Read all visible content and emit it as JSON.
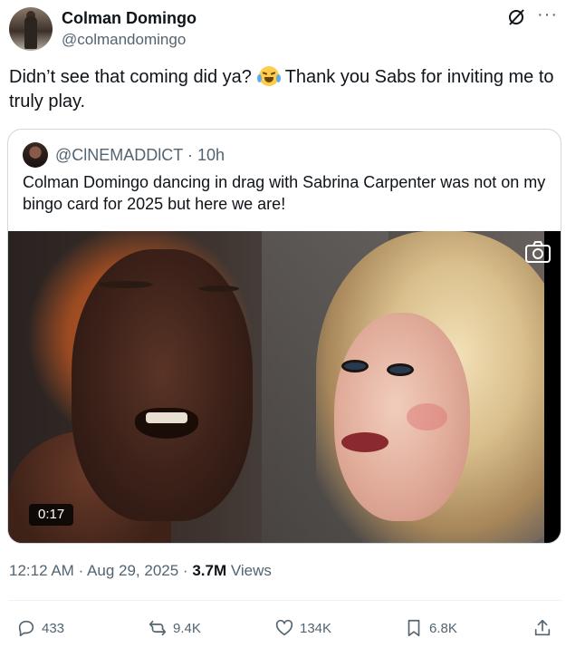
{
  "author": {
    "name": "Colman Domingo",
    "handle": "@colmandomingo"
  },
  "tweet": {
    "text_before_emoji": "Didn’t see that coming did ya?",
    "emoji": "face-with-tears-of-joy",
    "text_after_emoji": "Thank you Sabs for inviting me to truly play."
  },
  "quote": {
    "handle": "@ClNEMADDlCT",
    "separator": "·",
    "time": "10h",
    "text": "Colman Domingo dancing in drag with Sabrina Carpenter was not on my bingo card for 2025 but here we are!",
    "video_duration": "0:17"
  },
  "meta": {
    "time": "12:12 AM",
    "separator1": "·",
    "date": "Aug 29, 2025",
    "separator2": "·",
    "views_count": "3.7M",
    "views_label": "Views"
  },
  "actions": {
    "replies": "433",
    "reposts": "9.4K",
    "likes": "134K",
    "bookmarks": "6.8K"
  },
  "icons": [
    "grok-icon",
    "more-icon",
    "camera-icon",
    "reply-icon",
    "repost-icon",
    "like-icon",
    "bookmark-icon",
    "share-icon"
  ],
  "colors": {
    "text_primary": "#0f1419",
    "text_secondary": "#536471",
    "border": "#cfd9de"
  }
}
